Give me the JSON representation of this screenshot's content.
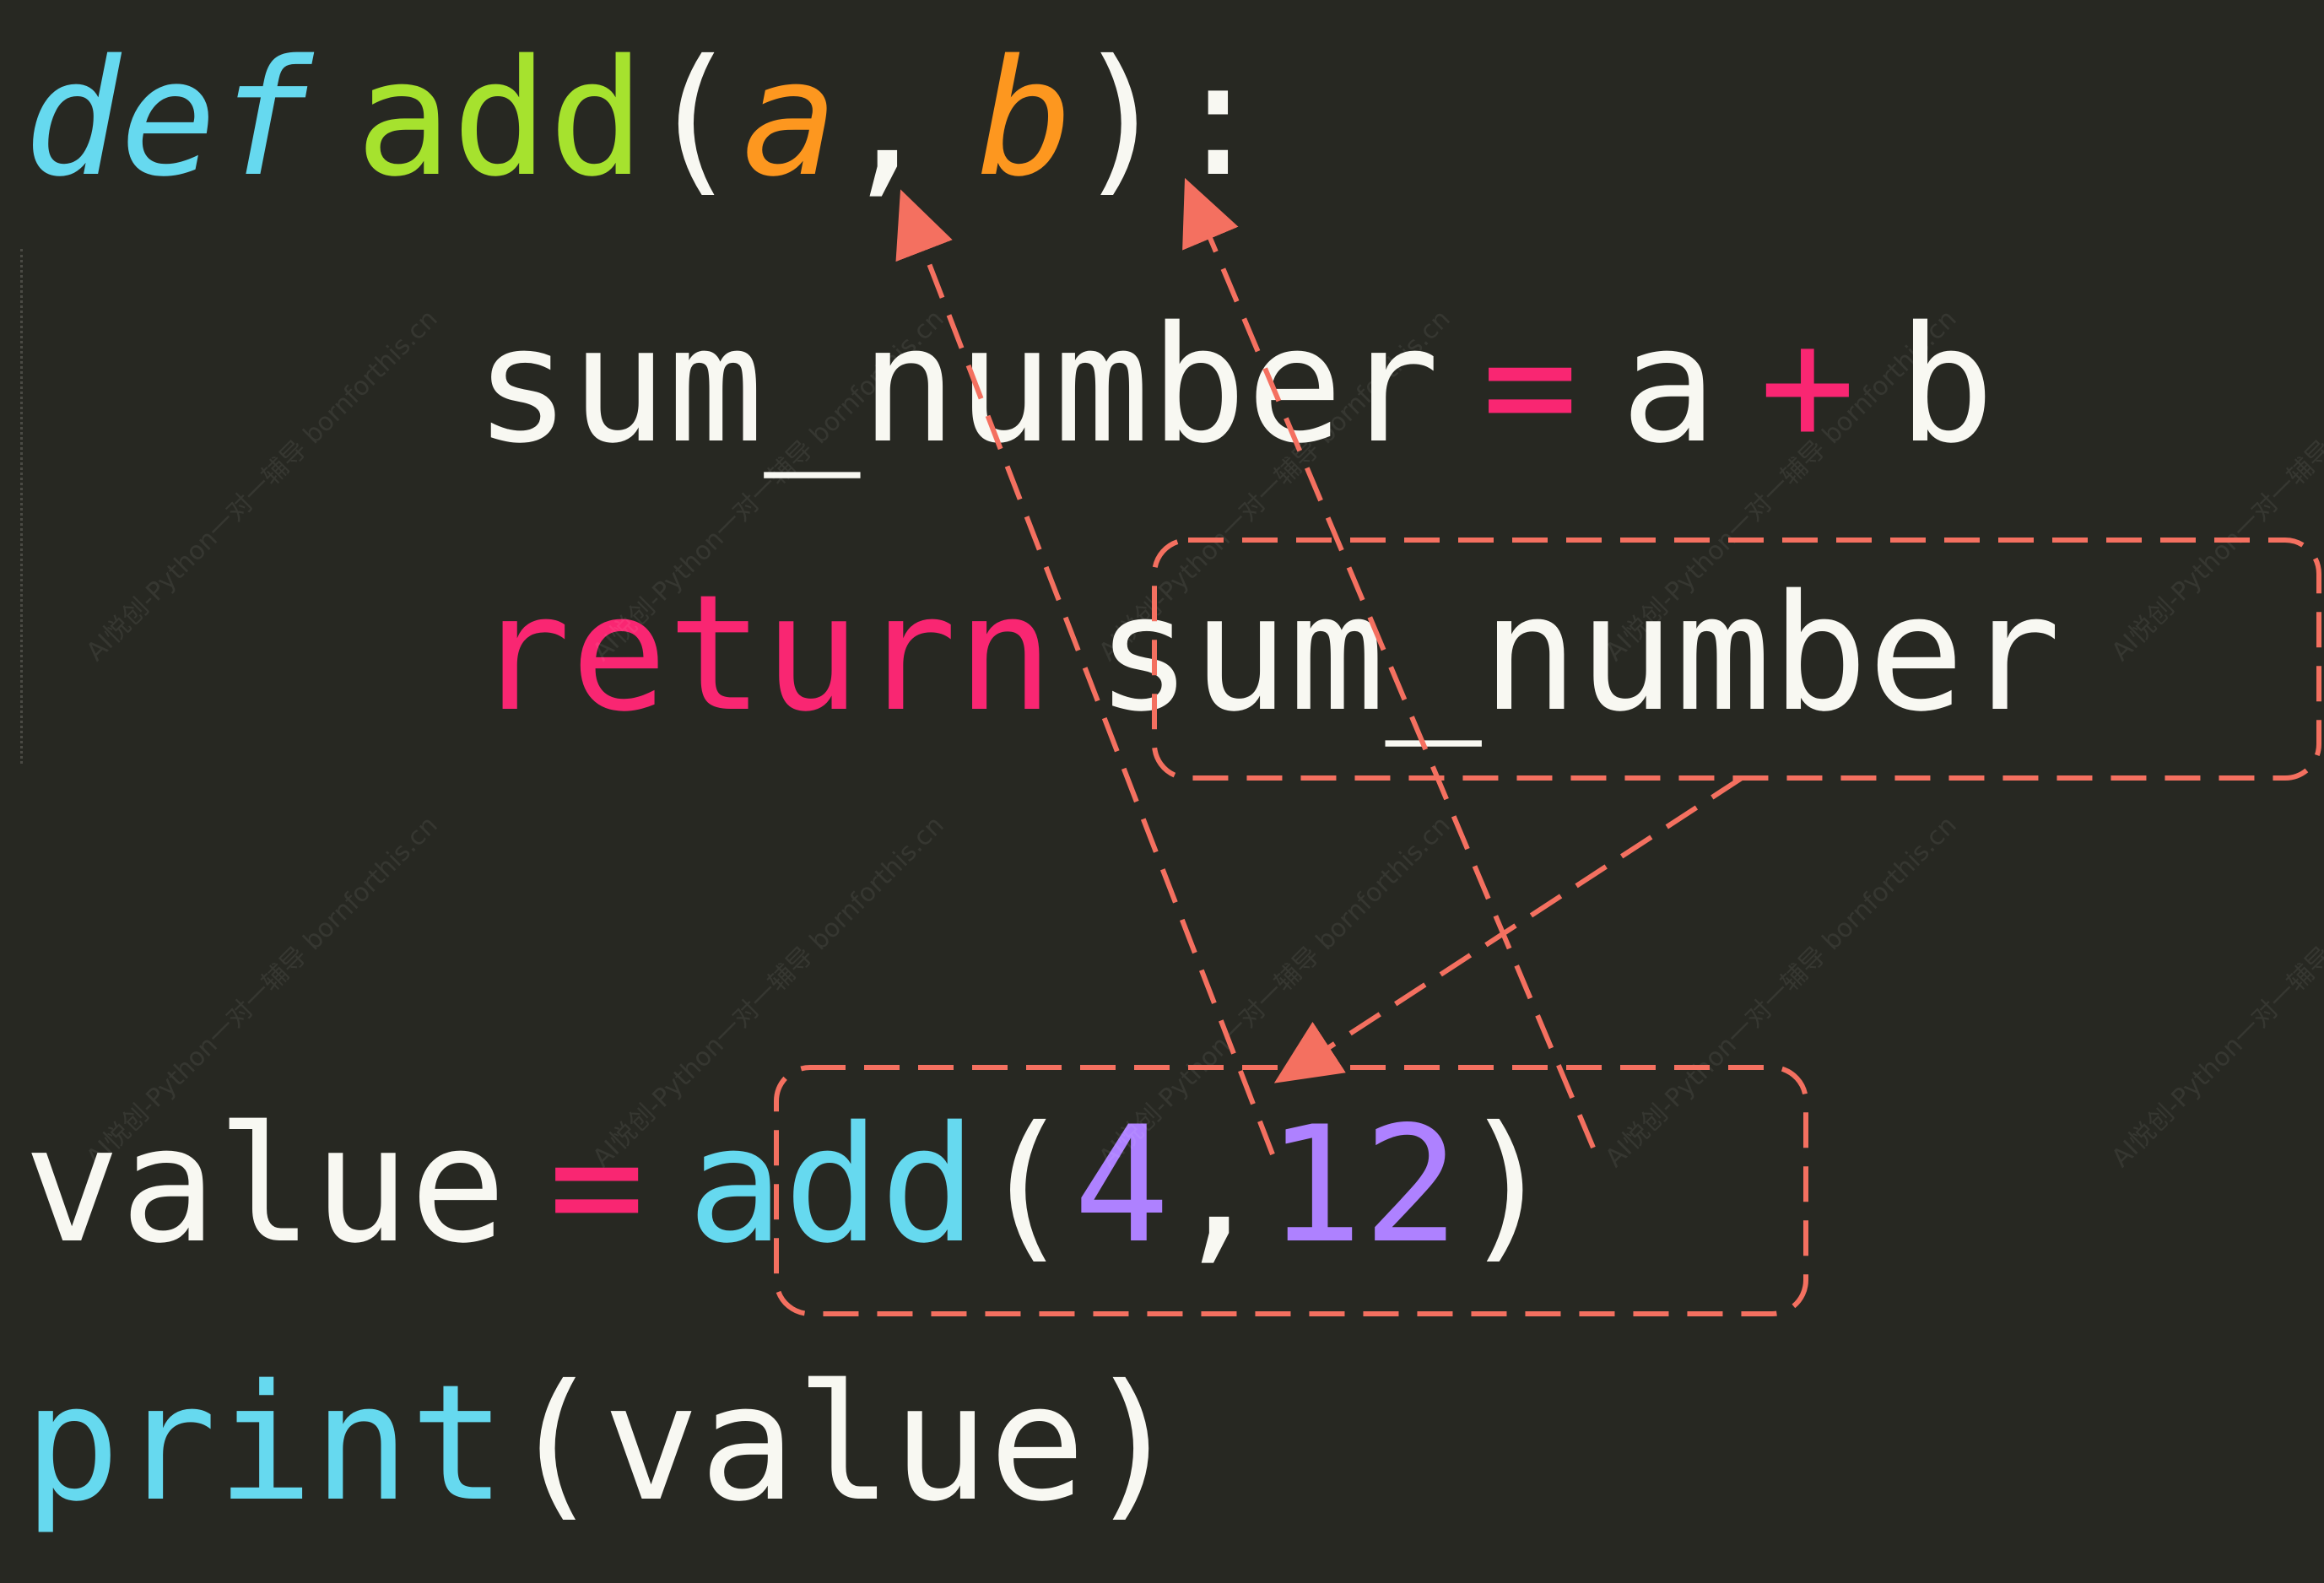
{
  "editor": {
    "lines": {
      "line1": {
        "keyword": "def",
        "function_name": "add",
        "open_paren": "(",
        "param_a": "a",
        "comma": ",",
        "param_b": "b",
        "close": "):"
      },
      "line2": {
        "variable": "sum_number",
        "assign": "=",
        "operand_a": "a",
        "plus": "+",
        "operand_b": "b"
      },
      "line3": {
        "keyword": "return",
        "value": "sum_number"
      },
      "line5": {
        "variable": "value",
        "assign": "=",
        "function_call": "add",
        "open_paren": "(",
        "arg1": "4",
        "comma": ",",
        "arg2": "12",
        "close_paren": ")"
      },
      "line6": {
        "builtin": "print",
        "open_paren": "(",
        "arg": "value",
        "close_paren": ")"
      }
    },
    "watermark_text": "AI悦创-Python一对一辅导 bornforthis.cn"
  },
  "colors": {
    "background": "#272822",
    "keyword_def": "#66d9ef",
    "function_name": "#a6e22e",
    "parameter": "#fd971f",
    "keyword_return": "#f92672",
    "operator": "#f92672",
    "builtin": "#66d9ef",
    "number": "#ae81ff",
    "plain_text": "#f8f8f2",
    "annotation": "#f47060"
  }
}
